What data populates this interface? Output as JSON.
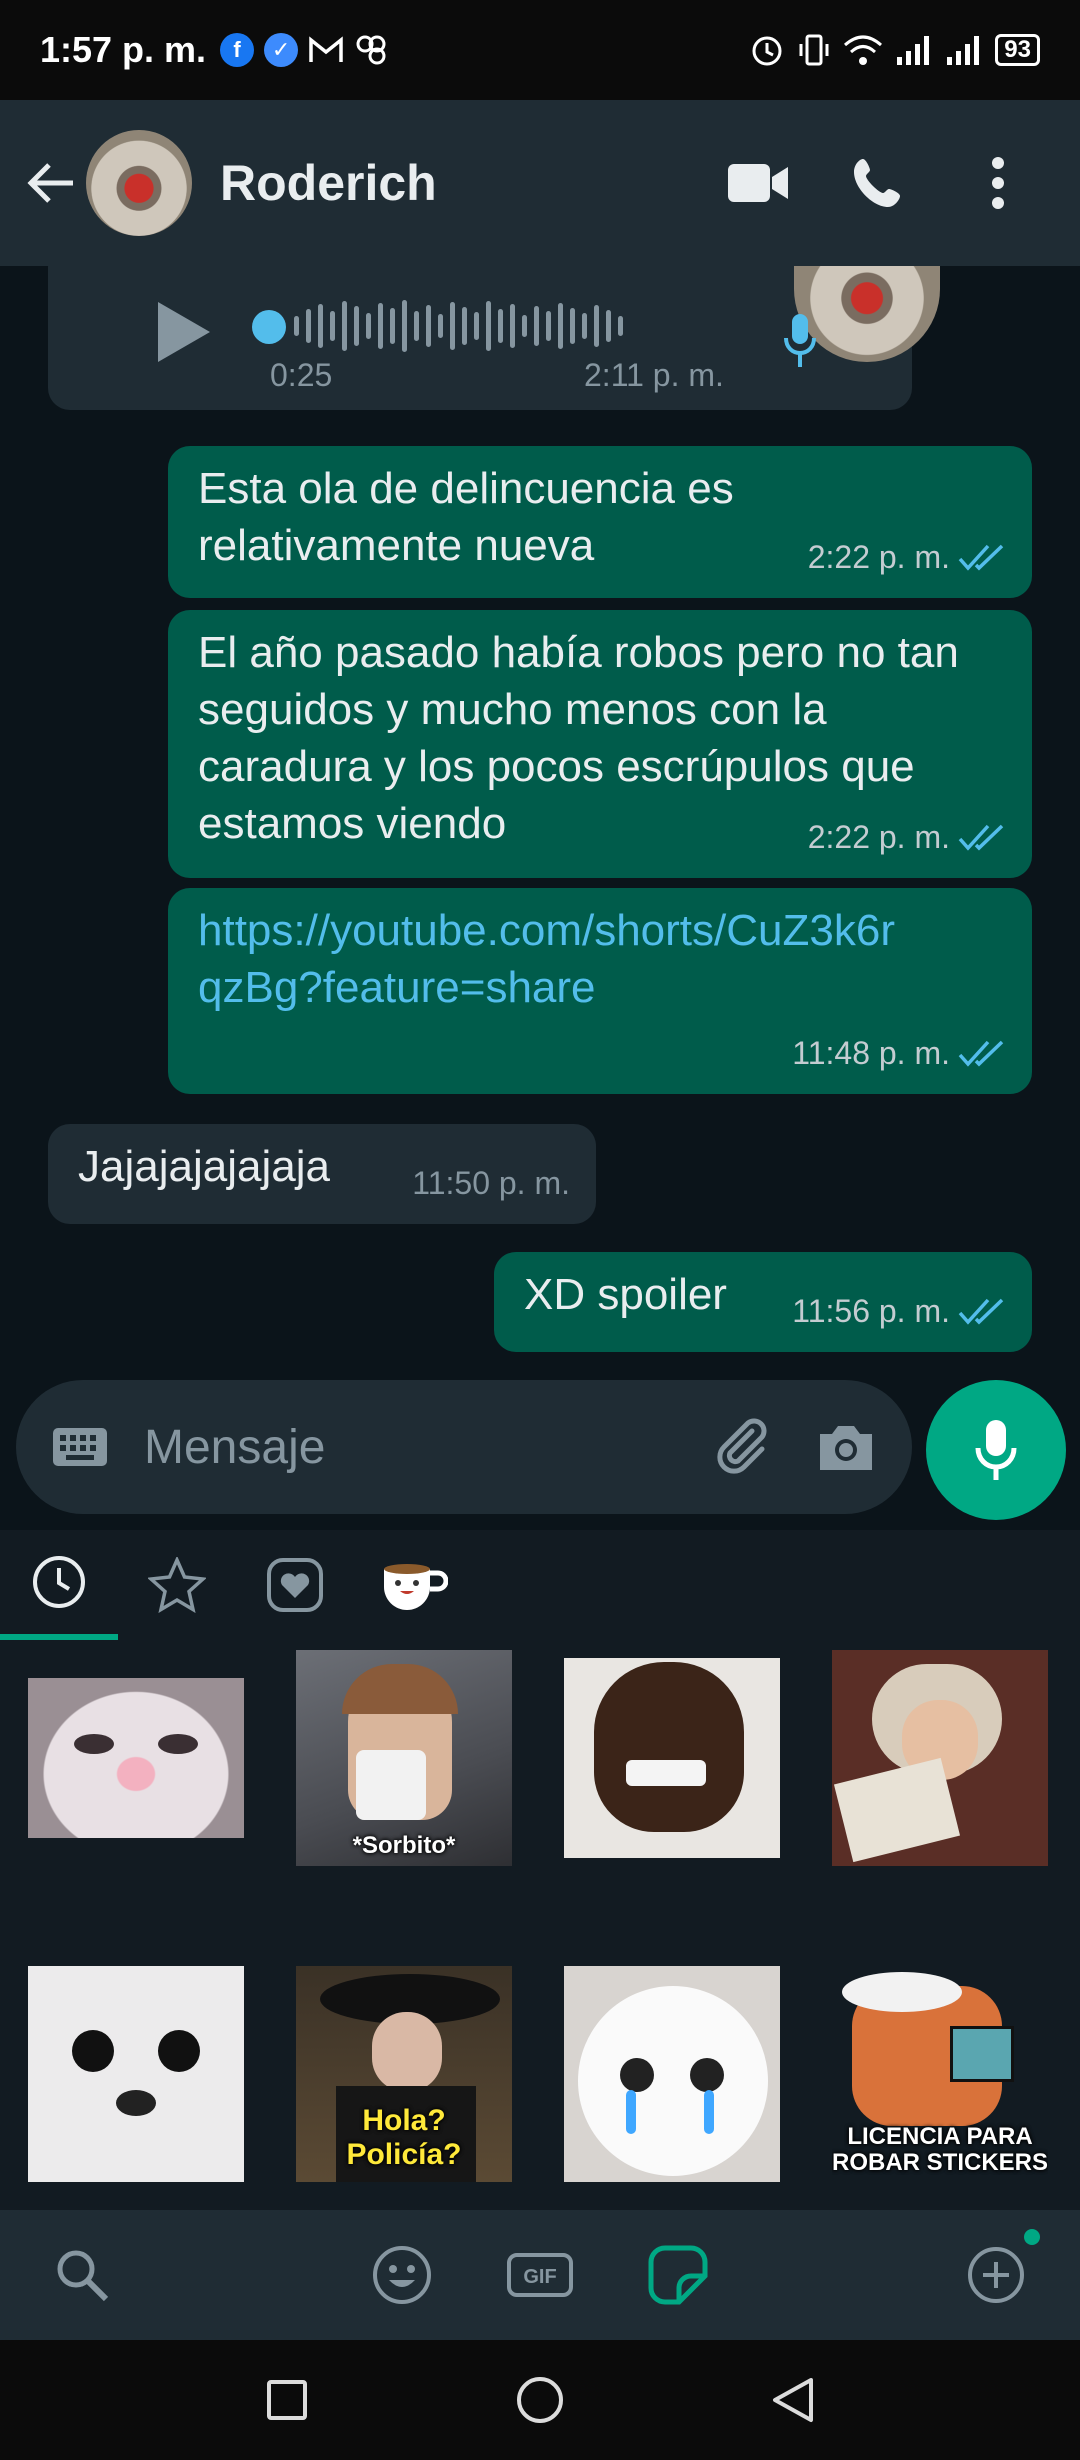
{
  "status_bar": {
    "time": "1:57 p. m.",
    "battery": "93",
    "left_icons": [
      "facebook-icon",
      "messenger-icon",
      "gmail-icon",
      "pinwheel-icon"
    ],
    "right_icons": [
      "alarm-icon",
      "vibrate-icon",
      "wifi-icon",
      "signal-icon",
      "signal-icon"
    ]
  },
  "header": {
    "contact_name": "Roderich",
    "actions": [
      "video-call-icon",
      "phone-icon",
      "more-vert-icon"
    ]
  },
  "voice_message": {
    "duration": "0:25",
    "time": "2:11 p. m."
  },
  "messages": [
    {
      "direction": "out",
      "text": "Esta ola de delincuencia es relativamente nueva",
      "time": "2:22 p. m.",
      "status": "read"
    },
    {
      "direction": "out",
      "text": "El año pasado había robos pero no tan seguidos y mucho menos con la caradura y los pocos escrúpulos que estamos viendo",
      "time": "2:22 p. m.",
      "status": "read"
    },
    {
      "direction": "out",
      "text": "https://youtube.com/shorts/CuZ3k6rqzBg?feature=share",
      "time": "11:48 p. m.",
      "status": "read"
    },
    {
      "direction": "in",
      "text": "Jajajajajajaja",
      "time": "11:50 p. m."
    },
    {
      "direction": "out",
      "text": "XD spoiler",
      "time": "11:56 p. m.",
      "status": "read"
    }
  ],
  "composer": {
    "placeholder": "Mensaje"
  },
  "sticker_panel": {
    "tabs": [
      "recent-icon",
      "star-icon",
      "heart-icon",
      "coffee-sticker-icon"
    ],
    "stickers": [
      {
        "name": "sticker-cat-face",
        "caption": ""
      },
      {
        "name": "sticker-boy-sipping",
        "caption": "*Sorbito*"
      },
      {
        "name": "sticker-cringe-face",
        "caption": ""
      },
      {
        "name": "sticker-old-man-reading",
        "caption": ""
      },
      {
        "name": "sticker-dog-face",
        "caption": ""
      },
      {
        "name": "sticker-lady-hat",
        "caption": "Hola?\nPolicía?"
      },
      {
        "name": "sticker-crying-cat",
        "caption": ""
      },
      {
        "name": "sticker-kuzco-license",
        "caption": "LICENCIA PARA\nROBAR STICKERS"
      }
    ],
    "bottom_icons": [
      "search-icon",
      "emoji-icon",
      "gif-icon",
      "sticker-icon",
      "add-icon"
    ]
  },
  "colors": {
    "accent": "#00a884",
    "outgoing": "#005c4b",
    "incoming": "#1f2c34",
    "background": "#0b141a",
    "link": "#53bdeb"
  }
}
